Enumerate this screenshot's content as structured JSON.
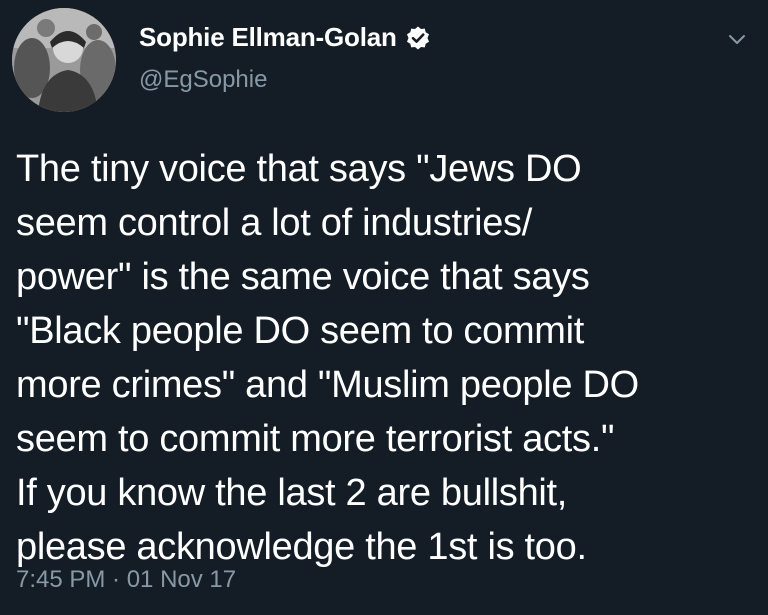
{
  "author": {
    "display_name": "Sophie Ellman-Golan",
    "handle": "@EgSophie",
    "verified": true,
    "avatar_icon": "profile-photo"
  },
  "tweet": {
    "lines": [
      "The tiny voice that says \"Jews DO",
      "seem control a lot of industries/",
      "power\" is the same voice that says",
      "\"Black people DO seem to commit",
      "more crimes\" and \"Muslim people DO",
      "seem to commit more terrorist acts.\"",
      "If you know the last 2 are bullshit,",
      "please acknowledge the 1st is too."
    ],
    "timestamp": "7:45 PM · 01 Nov 17"
  },
  "icons": {
    "verified": "verified-badge-icon",
    "menu": "chevron-down-icon"
  },
  "colors": {
    "background": "#141d26",
    "text_primary": "#ffffff",
    "text_secondary": "#8899a6"
  }
}
